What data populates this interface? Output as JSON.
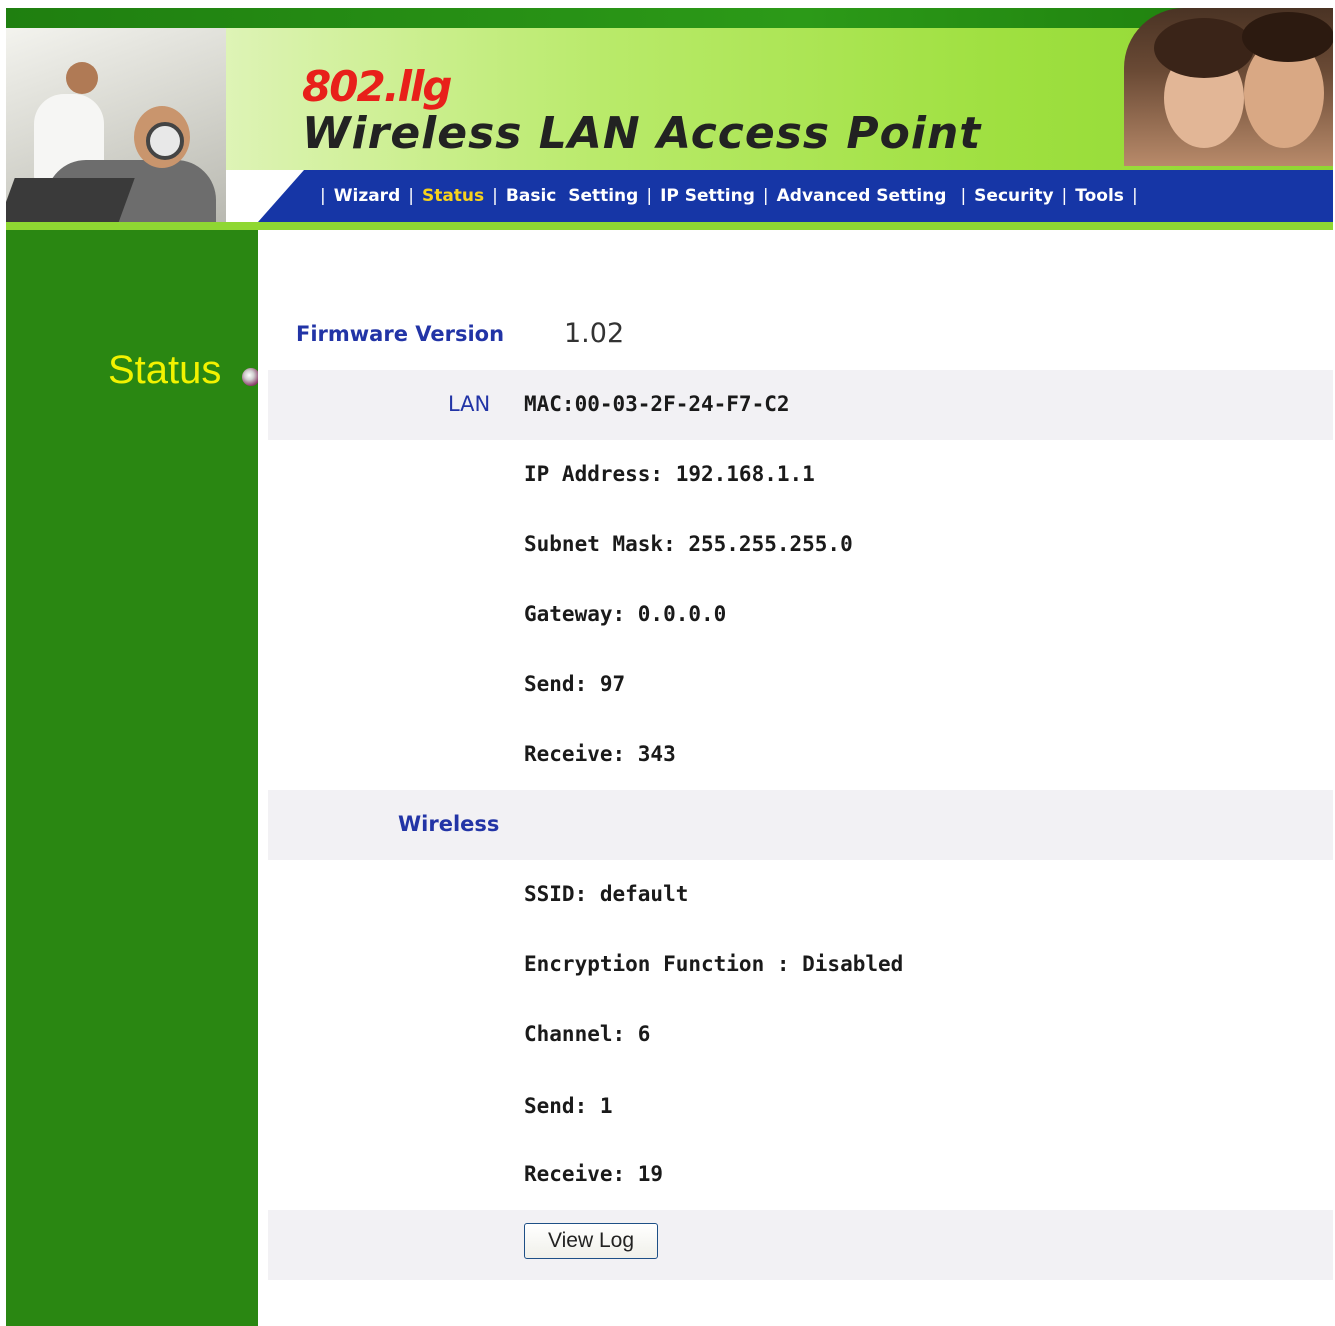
{
  "header": {
    "model": "802.llg",
    "title": "Wireless LAN Access Point"
  },
  "nav": {
    "items": [
      {
        "label": "Wizard",
        "active": false
      },
      {
        "label": "Status",
        "active": true
      },
      {
        "label": "Basic  Setting",
        "active": false
      },
      {
        "label": "IP Setting",
        "active": false
      },
      {
        "label": "Advanced Setting",
        "active": false
      },
      {
        "label": "Security",
        "active": false
      },
      {
        "label": "Tools",
        "active": false
      }
    ],
    "separator": "|"
  },
  "sidebar": {
    "title": "Status"
  },
  "firmware": {
    "label": "Firmware Version",
    "value": "1.02"
  },
  "lan": {
    "label": "LAN",
    "mac": "MAC:00-03-2F-24-F7-C2",
    "ip": "IP Address: 192.168.1.1",
    "subnet": "Subnet Mask: 255.255.255.0",
    "gateway": "Gateway: 0.0.0.0",
    "send": "Send: 97",
    "receive": "Receive: 343"
  },
  "wireless": {
    "label": "Wireless",
    "ssid": "SSID: default",
    "encryption": "Encryption Function : Disabled",
    "channel": "Channel: 6",
    "send": "Send: 1",
    "receive": "Receive: 19"
  },
  "actions": {
    "view_log": "View Log"
  },
  "colors": {
    "sidebar_green": "#2a8712",
    "nav_blue": "#1636a6",
    "active_nav": "#f7d21c",
    "label_blue": "#2234a6",
    "logo_red": "#e8201a",
    "sidebar_title_yellow": "#f2f200",
    "band_gray": "#f2f1f4"
  }
}
